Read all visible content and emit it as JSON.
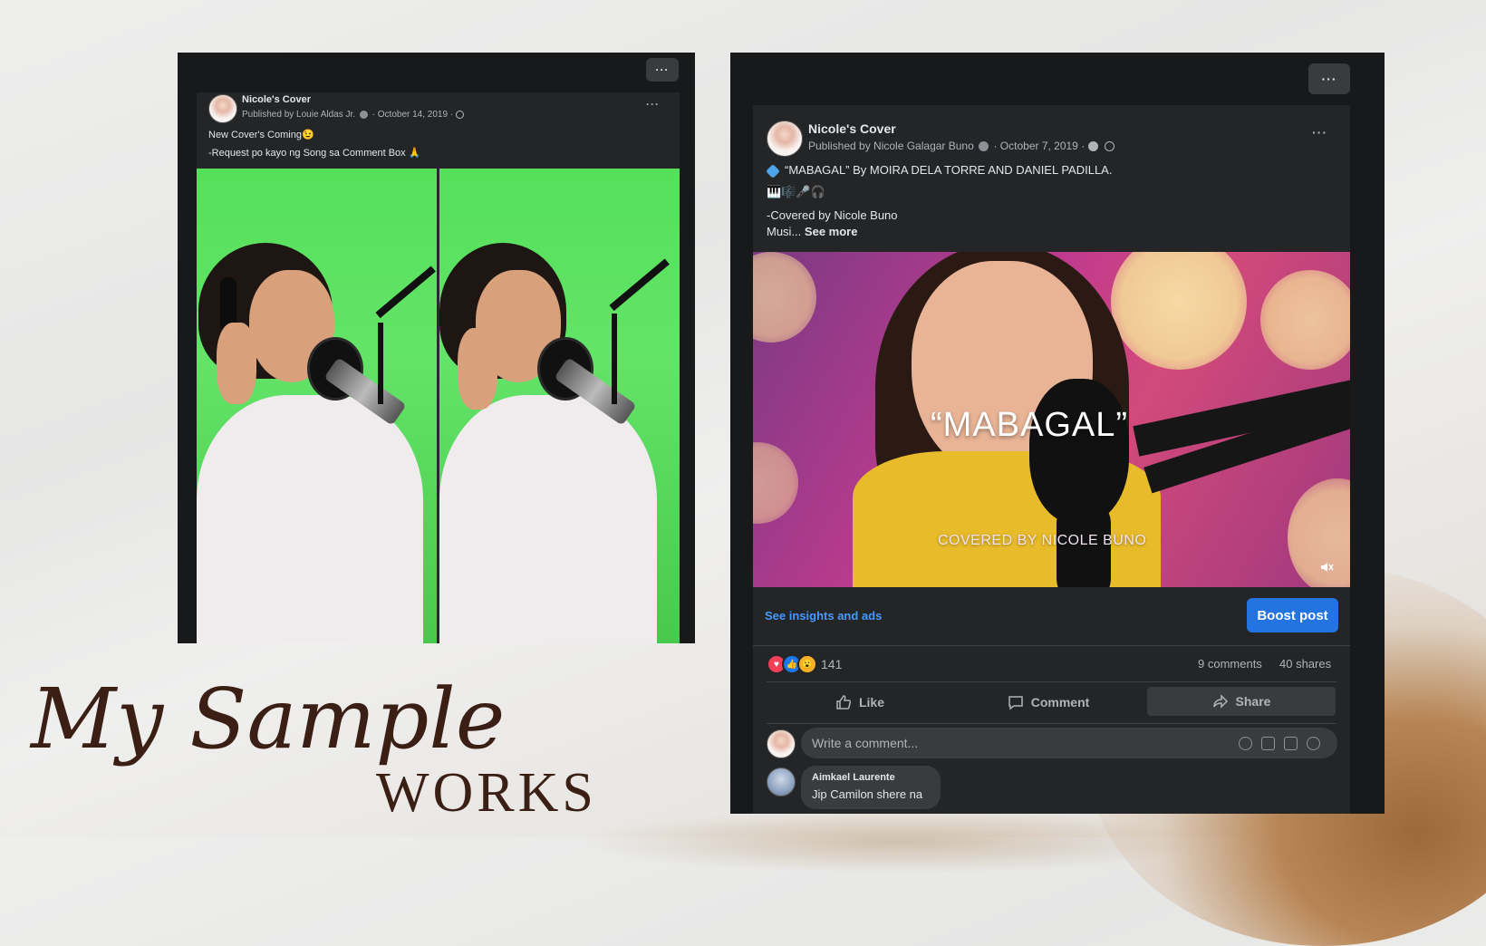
{
  "left_post": {
    "page_name": "Nicole's Cover",
    "published_by": "Published by Louie Aldas Jr.",
    "date": "· October 14, 2019 ·",
    "line1": "New Cover's Coming😉",
    "line2": "-Request po kayo ng Song sa Comment Box 🙏",
    "options_label": "···",
    "post_options_label": "···"
  },
  "right_post": {
    "page_name": "Nicole's Cover",
    "published_by": "Published by Nicole Galagar Buno",
    "date": "· October 7, 2019 ·",
    "line1": "“MABAGAL” By MOIRA DELA TORRE AND DANIEL PADILLA.",
    "line2": "🎹🎼🎤🎧",
    "line3": "-Covered by Nicole Buno",
    "line4_prefix": "Musi...",
    "see_more": "See more",
    "video_title": "“MABAGAL”",
    "video_subtitle": "COVERED BY NICOLE BUNO",
    "insights_link": "See insights and ads",
    "boost_button": "Boost post",
    "reaction_count": "141",
    "comments_count": "9 comments",
    "shares_count": "40 shares",
    "like_label": "Like",
    "comment_label": "Comment",
    "share_label": "Share",
    "comment_placeholder": "Write a comment...",
    "commenter_name": "Aimkael Laurente",
    "comment_text": "Jip Camilon shere na",
    "options_label": "···",
    "post_options_label": "···"
  },
  "heading": {
    "script": "My Sample",
    "caps": "WORKS"
  },
  "colors": {
    "fb_blue": "#2374e1",
    "link_blue": "#4599ff",
    "dark_bg": "#242526",
    "heading_brown": "#3b1f14"
  }
}
